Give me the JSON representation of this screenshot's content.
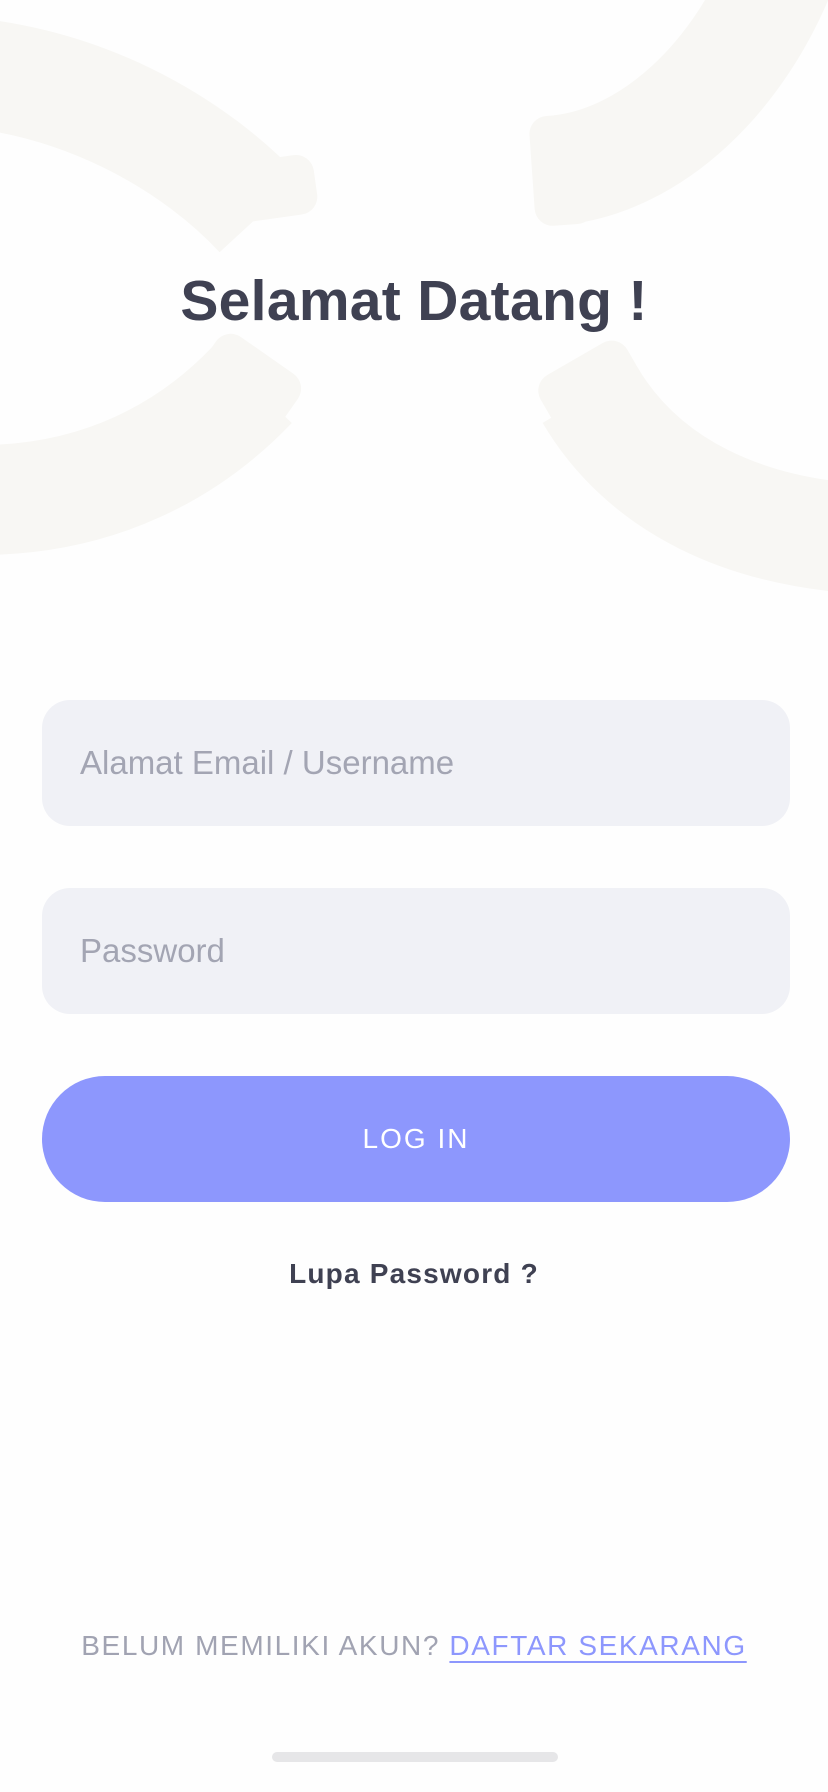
{
  "header": {
    "title": "Selamat Datang !"
  },
  "form": {
    "email_placeholder": "Alamat Email / Username",
    "email_value": "",
    "password_placeholder": "Password",
    "password_value": "",
    "login_label": "LOG IN",
    "forgot_label": "Lupa Password ?"
  },
  "footer": {
    "prompt": "BELUM MEMILIKI AKUN?",
    "signup_label": "DAFTAR SEKARANG"
  },
  "colors": {
    "accent": "#8D97FD",
    "title_text": "#3F4152",
    "field_background": "#F0F1F6",
    "decor_shape": "#F8F7F4",
    "muted_text": "#A1A3B2"
  }
}
